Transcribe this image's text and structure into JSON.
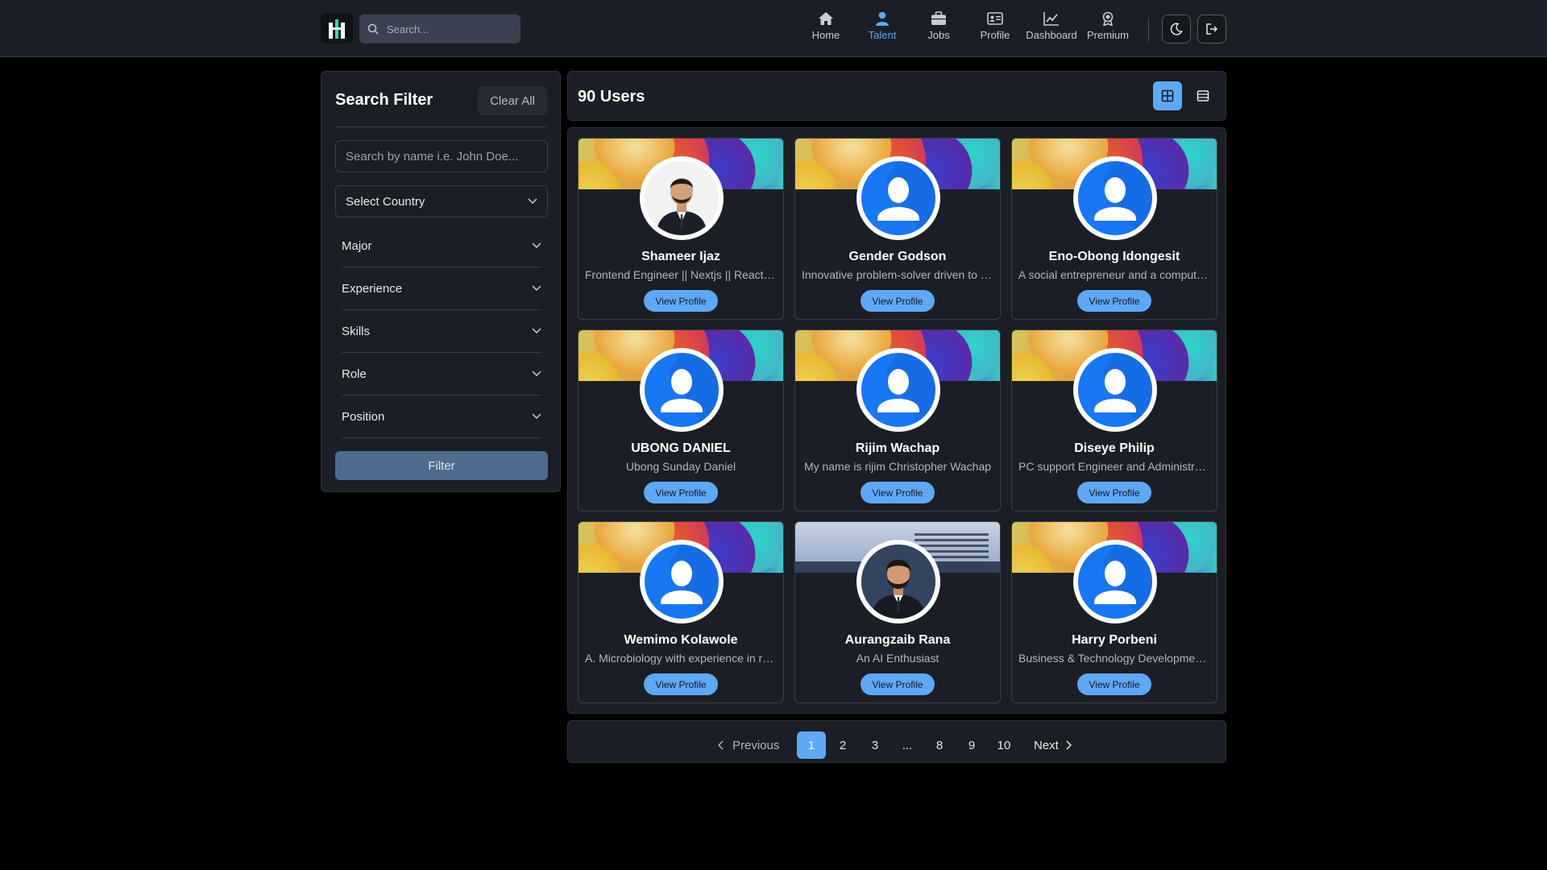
{
  "header": {
    "search_placeholder": "Search...",
    "nav": [
      {
        "label": "Home",
        "icon": "home-icon"
      },
      {
        "label": "Talent",
        "icon": "user-icon",
        "active": true
      },
      {
        "label": "Jobs",
        "icon": "briefcase-icon"
      },
      {
        "label": "Profile",
        "icon": "id-card-icon"
      },
      {
        "label": "Dashboard",
        "icon": "chart-icon"
      },
      {
        "label": "Premium",
        "icon": "award-icon"
      }
    ],
    "theme_toggle_icon": "moon-icon",
    "logout_icon": "logout-icon"
  },
  "sidebar": {
    "title": "Search Filter",
    "clear_label": "Clear All",
    "name_placeholder": "Search by name i.e. John Doe...",
    "country_label": "Select Country",
    "accordion": [
      "Major",
      "Experience",
      "Skills",
      "Role",
      "Position"
    ],
    "filter_label": "Filter"
  },
  "main": {
    "count_label": "90 Users",
    "view_modes": [
      "grid-view-icon",
      "list-view-icon"
    ],
    "active_view": "grid",
    "view_profile_label": "View Profile",
    "cards": [
      {
        "name": "Shameer Ijaz",
        "bio": "Frontend Engineer || Nextjs || React || Tailwind",
        "avatar": "photo-light",
        "banner": "gradient"
      },
      {
        "name": "Gender Godson",
        "bio": "Innovative problem-solver driven to excel",
        "avatar": "generic",
        "banner": "gradient"
      },
      {
        "name": "Eno-Obong Idongesit",
        "bio": "A social entrepreneur and a computer scientist",
        "avatar": "generic",
        "banner": "gradient"
      },
      {
        "name": "UBONG DANIEL",
        "bio": "Ubong Sunday Daniel",
        "avatar": "generic",
        "banner": "gradient"
      },
      {
        "name": "Rijim Wachap",
        "bio": "My name is rijim Christopher Wachap",
        "avatar": "generic",
        "banner": "gradient"
      },
      {
        "name": "Diseye Philip",
        "bio": "PC support Engineer and Administrator",
        "avatar": "generic",
        "banner": "gradient"
      },
      {
        "name": "Wemimo Kolawole",
        "bio": "A. Microbiology with experience in research",
        "avatar": "generic",
        "banner": "gradient"
      },
      {
        "name": "Aurangzaib Rana",
        "bio": "An AI Enthusiast",
        "avatar": "photo-dark",
        "banner": "photo"
      },
      {
        "name": "Harry Porbeni",
        "bio": "Business & Technology Development Specialist",
        "avatar": "generic",
        "banner": "gradient"
      }
    ]
  },
  "pagination": {
    "previous_label": "Previous",
    "next_label": "Next",
    "pages": [
      "1",
      "2",
      "3",
      "...",
      "8",
      "9",
      "10"
    ],
    "current": "1"
  },
  "colors": {
    "accent": "#5fa8f5",
    "panel": "#1b1f25",
    "filter_button": "#4e6b8d",
    "avatar_blue": "#1877f2"
  }
}
